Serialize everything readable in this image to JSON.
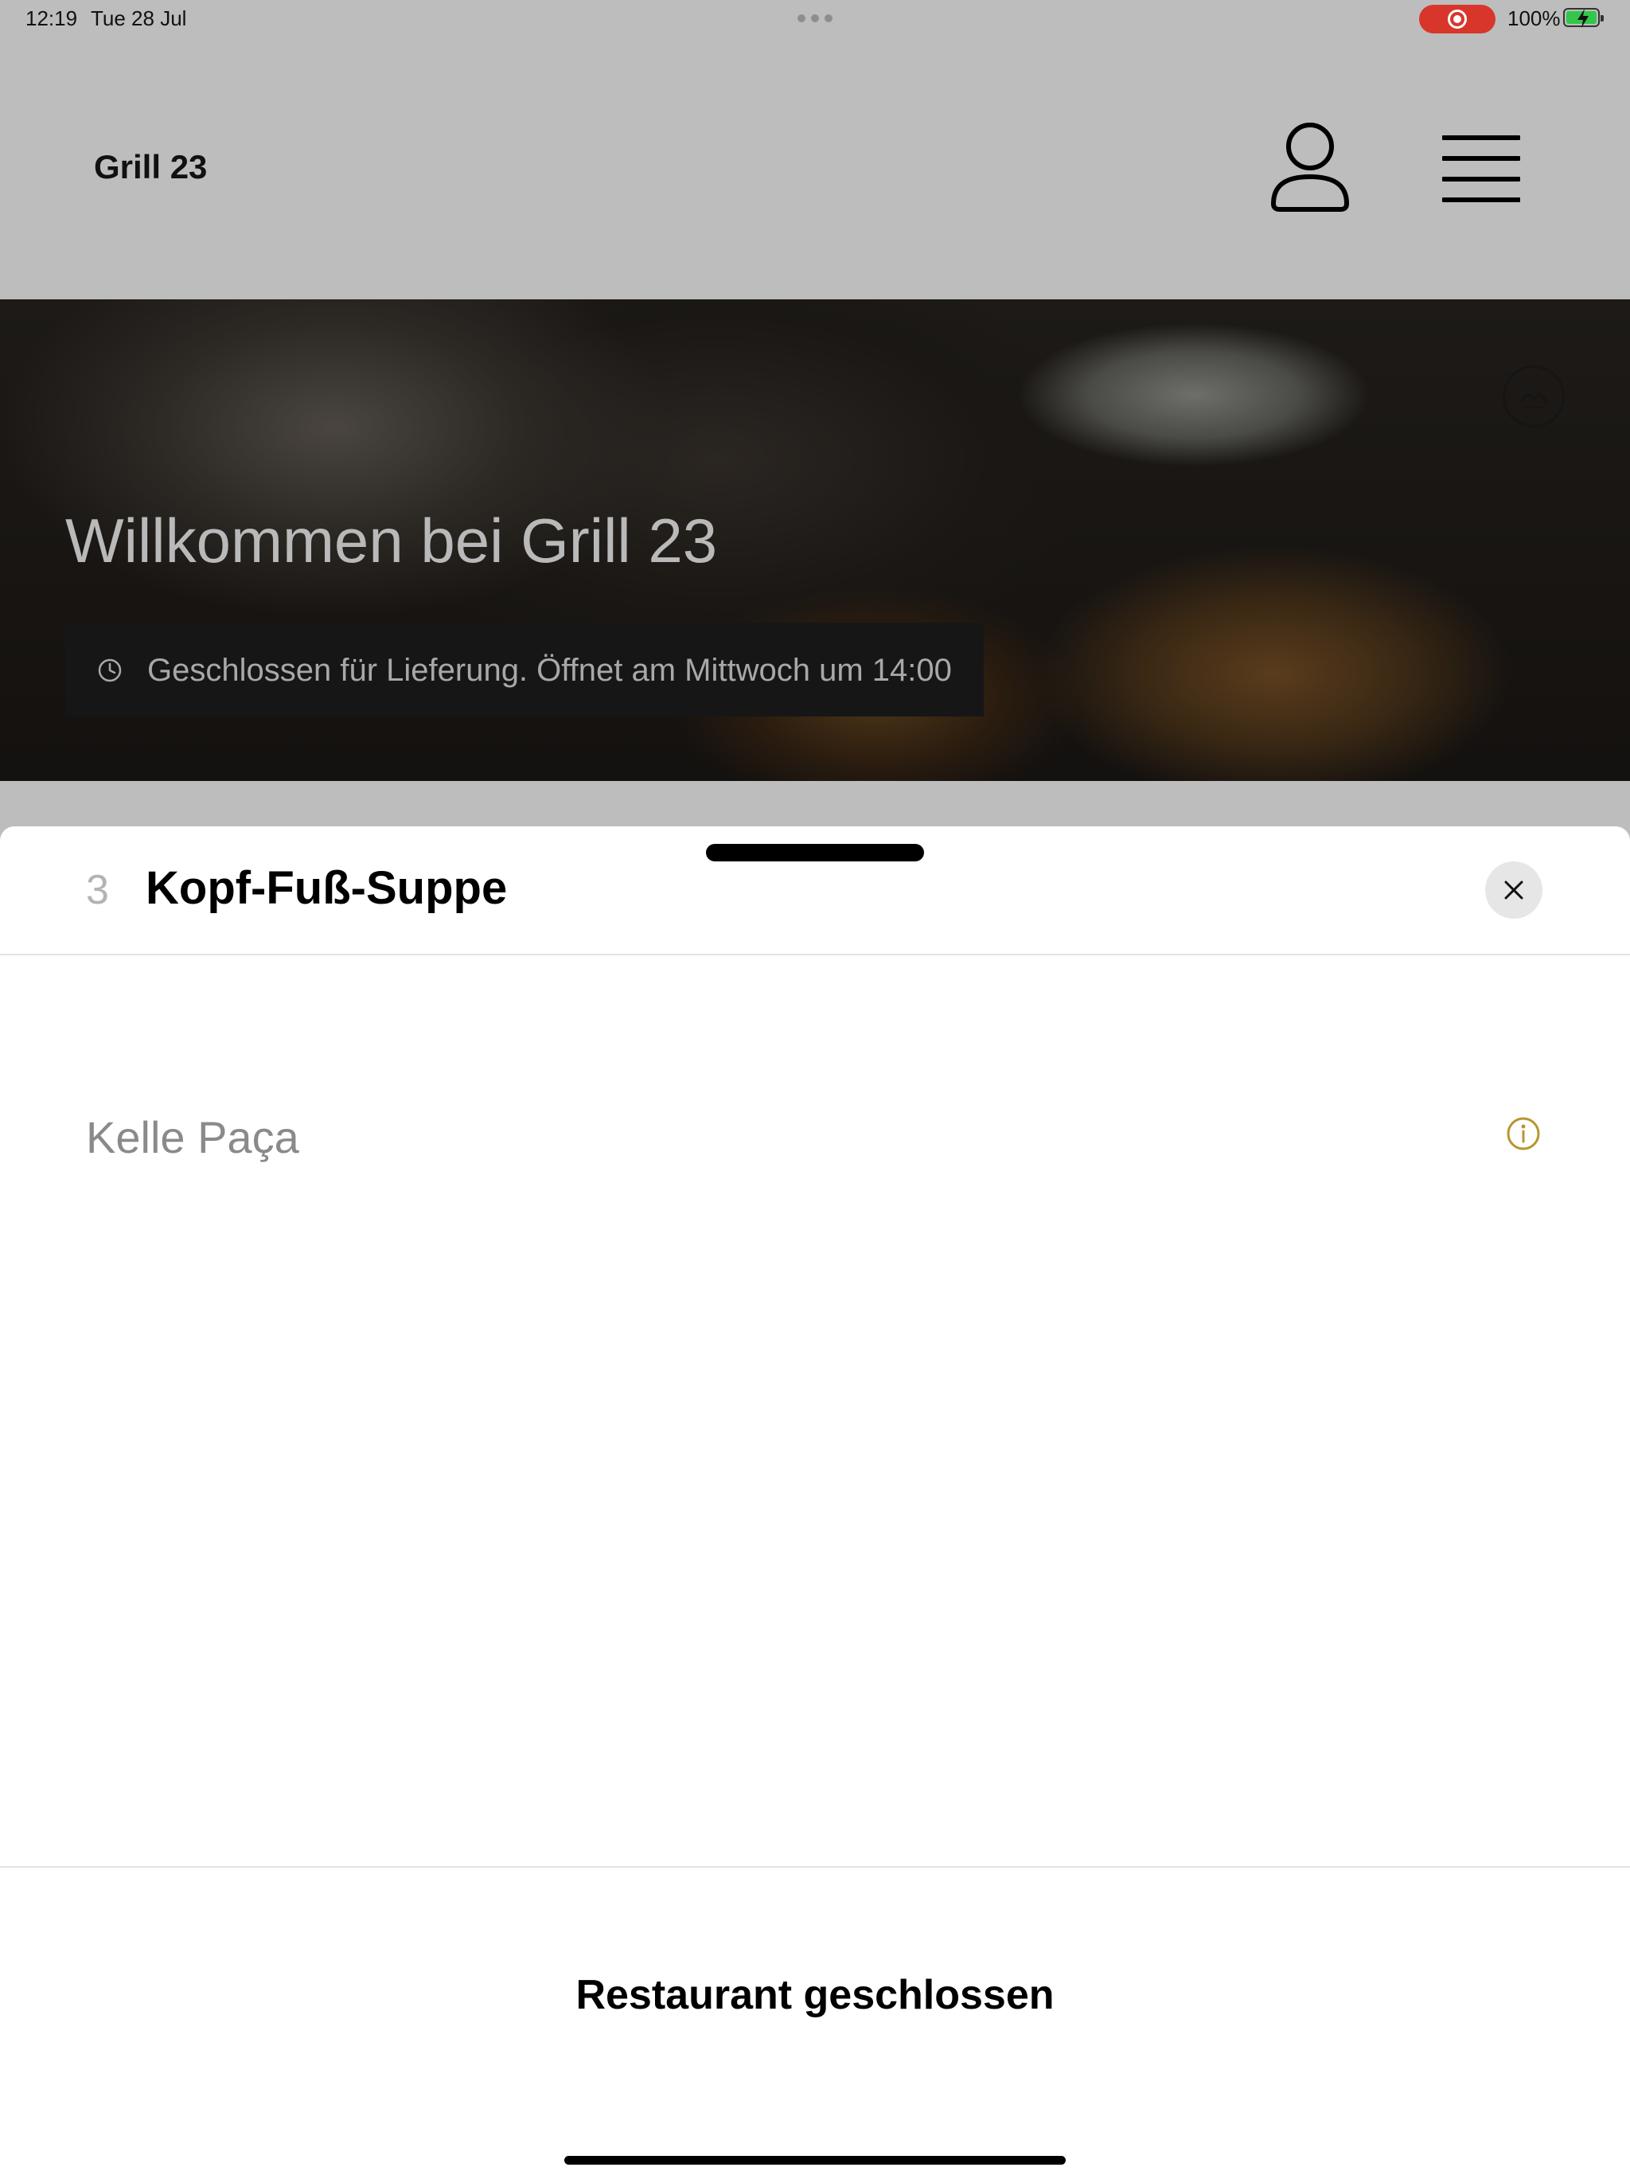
{
  "status_bar": {
    "time": "12:19",
    "date": "Tue 28 Jul",
    "battery_percent": "100%",
    "battery_level": 1.0,
    "recording_indicator_color": "#d9362b",
    "battery_color": "#32c74b"
  },
  "header": {
    "brand": "Grill 23",
    "account_icon": "person-icon",
    "menu_icon": "hamburger-menu-icon"
  },
  "hero": {
    "title": "Willkommen bei Grill 23",
    "hours_notice": "Geschlossen für Lieferung. Öffnet am Mittwoch um 14:00",
    "clock_icon": "clock-icon",
    "badge_icon": "halal-badge-icon"
  },
  "item_sheet": {
    "number": "3",
    "title": "Kopf-Fuß-Suppe",
    "subtitle": "Kelle Paça",
    "info_icon": "info-icon",
    "info_icon_color": "#b8962f",
    "close_icon": "close-icon",
    "footer_status": "Restaurant geschlossen"
  }
}
